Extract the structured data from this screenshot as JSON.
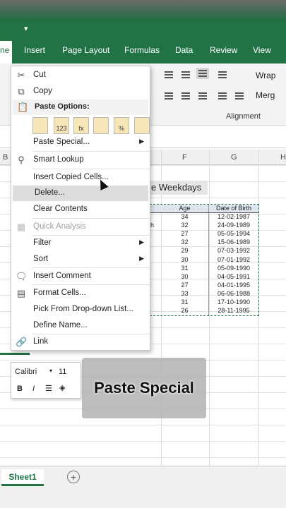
{
  "quick_access": {
    "customize_glyph": "▾"
  },
  "ribbon_tabs": [
    {
      "label": "ne"
    },
    {
      "label": "Insert"
    },
    {
      "label": "Page Layout"
    },
    {
      "label": "Formulas"
    },
    {
      "label": "Data"
    },
    {
      "label": "Review"
    },
    {
      "label": "View"
    }
  ],
  "ribbon": {
    "wrap_label": "Wrap",
    "merge_label": "Merg",
    "alignment_group_label": "Alignment"
  },
  "columns": [
    "B",
    "F",
    "G",
    "H"
  ],
  "sheet": {
    "weekday_text": "e Weekdays",
    "table_headers": [
      "Age",
      "Date of Birth"
    ],
    "rows": [
      {
        "prefix": "",
        "age": "34",
        "dob": "12-02-1987"
      },
      {
        "prefix": "h",
        "age": "32",
        "dob": "24-09-1989"
      },
      {
        "prefix": "",
        "age": "27",
        "dob": "05-05-1994"
      },
      {
        "prefix": "",
        "age": "32",
        "dob": "15-06-1989"
      },
      {
        "prefix": "",
        "age": "29",
        "dob": "07-03-1992"
      },
      {
        "prefix": "",
        "age": "30",
        "dob": "07-01-1992"
      },
      {
        "prefix": "",
        "age": "31",
        "dob": "05-09-1990"
      },
      {
        "prefix": "",
        "age": "30",
        "dob": "04-05-1991"
      },
      {
        "prefix": "",
        "age": "27",
        "dob": "04-01-1995"
      },
      {
        "prefix": "",
        "age": "33",
        "dob": "06-06-1988"
      },
      {
        "prefix": "",
        "age": "31",
        "dob": "17-10-1990"
      },
      {
        "prefix": "",
        "age": "26",
        "dob": "28-11-1995"
      }
    ]
  },
  "context_menu": {
    "cut": "Cut",
    "copy": "Copy",
    "paste_options": "Paste Options:",
    "paste_icon_labels": [
      "",
      "123",
      "fx",
      "",
      "%",
      ""
    ],
    "paste_special": "Paste Special...",
    "smart_lookup": "Smart Lookup",
    "insert_copied_cells": "Insert Copied Cells...",
    "delete": "Delete...",
    "clear_contents": "Clear Contents",
    "quick_analysis": "Quick Analysis",
    "filter": "Filter",
    "sort": "Sort",
    "insert_comment": "Insert Comment",
    "format_cells": "Format Cells...",
    "pick_from_dropdown": "Pick From Drop-down List...",
    "define_name": "Define Name...",
    "link": "Link"
  },
  "mini_toolbar": {
    "font": "Calibri",
    "size": "11",
    "bold": "B",
    "italic": "I"
  },
  "caption": "Paste Special",
  "sheet_tab": "Sheet1",
  "add_sheet": "+"
}
